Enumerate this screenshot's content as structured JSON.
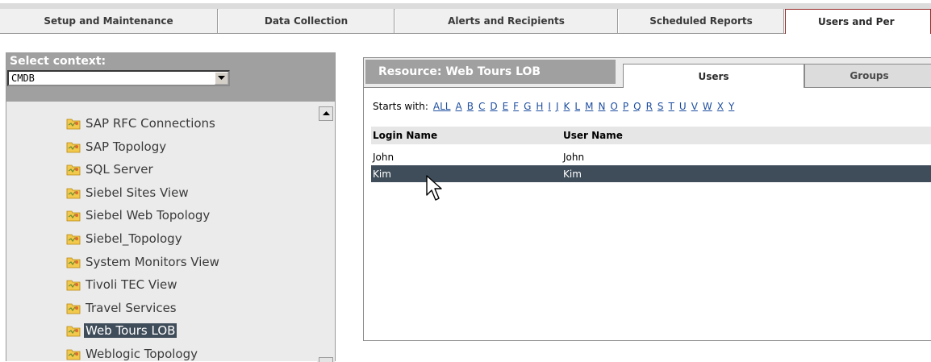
{
  "top_tabs": [
    {
      "label": "Setup and Maintenance"
    },
    {
      "label": "Data Collection"
    },
    {
      "label": "Alerts and Recipients"
    },
    {
      "label": "Scheduled Reports"
    },
    {
      "label": "Users and Per"
    }
  ],
  "context": {
    "label": "Select context:",
    "selected": "CMDB"
  },
  "tree": {
    "items": [
      {
        "label": "SAP RFC Connections",
        "icon": "folder-icon"
      },
      {
        "label": "SAP Topology",
        "icon": "folder-icon"
      },
      {
        "label": "SQL Server",
        "icon": "folder-icon"
      },
      {
        "label": "Siebel Sites View",
        "icon": "folder-icon"
      },
      {
        "label": "Siebel Web Topology",
        "icon": "folder-icon"
      },
      {
        "label": "Siebel_Topology",
        "icon": "folder-icon"
      },
      {
        "label": "System Monitors View",
        "icon": "folder-icon"
      },
      {
        "label": "Tivoli TEC View",
        "icon": "folder-icon"
      },
      {
        "label": "Travel Services",
        "icon": "folder-icon"
      },
      {
        "label": "Web Tours LOB",
        "icon": "folder-icon",
        "selected": true
      },
      {
        "label": "Weblogic Topology",
        "icon": "folder-icon"
      }
    ]
  },
  "resource": {
    "title": "Resource: Web Tours LOB",
    "tabs": {
      "users": "Users",
      "groups": "Groups"
    }
  },
  "starts_with": {
    "label": "Starts with:",
    "letters": [
      "ALL",
      "A",
      "B",
      "C",
      "D",
      "E",
      "F",
      "G",
      "H",
      "I",
      "J",
      "K",
      "L",
      "M",
      "N",
      "O",
      "P",
      "Q",
      "R",
      "S",
      "T",
      "U",
      "V",
      "W",
      "X",
      "Y"
    ]
  },
  "table": {
    "columns": [
      "Login Name",
      "User Name"
    ],
    "rows": [
      {
        "login": "John",
        "user": "John",
        "selected": false
      },
      {
        "login": "Kim",
        "user": "Kim",
        "selected": true
      }
    ]
  },
  "colors": {
    "selection": "#3f4d5a",
    "header_gray": "#a0a0a0",
    "link_blue": "#1f4f9f",
    "active_tab_border": "#9a2a2a"
  }
}
